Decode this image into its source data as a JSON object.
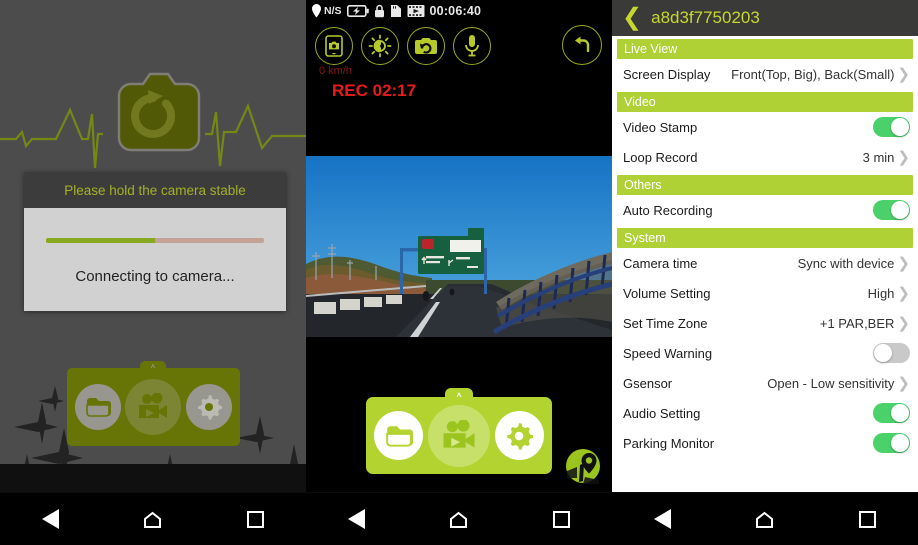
{
  "panel1": {
    "name": "connecting-screen",
    "logo_icon": "camera-refresh-icon",
    "dialog": {
      "title": "Please hold the camera stable",
      "message": "Connecting to camera...",
      "progress_percent": 50,
      "progress_fill_color": "#a5ce27",
      "progress_track_color": "#f0c7b7"
    },
    "toolbar": {
      "items": [
        {
          "icon": "folder-icon",
          "name": "gallery-button"
        },
        {
          "icon": "video-camera-icon",
          "name": "live-view-button"
        },
        {
          "icon": "gear-icon",
          "name": "settings-button"
        }
      ],
      "expand_chevron": "˄"
    }
  },
  "panel2": {
    "name": "live-view-screen",
    "statusbar": {
      "gps_label": "N/S",
      "time": "00:06:40",
      "icons": [
        "location-pin-icon",
        "battery-charging-icon",
        "lock-icon",
        "sd-card-icon",
        "film-strip-icon"
      ]
    },
    "tools": [
      {
        "icon": "phone-snapshot-icon",
        "name": "snapshot-to-phone-button"
      },
      {
        "icon": "brightness-icon",
        "name": "brightness-button"
      },
      {
        "icon": "camera-switch-icon",
        "name": "camera-switch-button"
      },
      {
        "icon": "microphone-icon",
        "name": "microphone-button"
      }
    ],
    "back_icon": "back-arrow-icon",
    "speed": "0 km/h",
    "rec_status": "REC 02:17",
    "speed_color": "#8c1313",
    "rec_color": "#e81b1b",
    "gps_map_icon": "map-pin-icon",
    "toolbar": {
      "items": [
        {
          "icon": "folder-icon",
          "name": "gallery-button"
        },
        {
          "icon": "video-camera-icon",
          "name": "live-view-button"
        },
        {
          "icon": "gear-icon",
          "name": "settings-button"
        }
      ],
      "expand_chevron": "˄"
    }
  },
  "panel3": {
    "name": "settings-screen",
    "header": {
      "back_icon": "chevron-left-icon",
      "title": "a8d3f7750203"
    },
    "accent_color": "#b0d136",
    "toggle_on_color": "#4ad16a",
    "toggle_off_color": "#c9c9c9",
    "sections": [
      {
        "title": "Live View",
        "rows": [
          {
            "label": "Screen Display",
            "value": "Front(Top, Big), Back(Small)",
            "type": "chevron"
          }
        ]
      },
      {
        "title": "Video",
        "rows": [
          {
            "label": "Video Stamp",
            "value": "",
            "type": "toggle",
            "state": "on"
          },
          {
            "label": "Loop Record",
            "value": "3 min",
            "type": "chevron"
          }
        ]
      },
      {
        "title": "Others",
        "rows": [
          {
            "label": "Auto Recording",
            "value": "",
            "type": "toggle",
            "state": "on"
          }
        ]
      },
      {
        "title": "System",
        "rows": [
          {
            "label": "Camera time",
            "value": "Sync with device",
            "type": "chevron"
          },
          {
            "label": "Volume Setting",
            "value": "High",
            "type": "chevron"
          },
          {
            "label": "Set Time Zone",
            "value": "+1 PAR,BER",
            "type": "chevron"
          },
          {
            "label": "Speed Warning",
            "value": "",
            "type": "toggle",
            "state": "off"
          },
          {
            "label": "Gsensor",
            "value": "Open - Low sensitivity",
            "type": "chevron"
          },
          {
            "label": "Audio Setting",
            "value": "",
            "type": "toggle",
            "state": "on"
          },
          {
            "label": "Parking Monitor",
            "value": "",
            "type": "toggle",
            "state": "on"
          }
        ]
      }
    ]
  },
  "navbar": {
    "back_icon": "triangle-back-icon",
    "home_icon": "home-icon",
    "recents_icon": "square-recents-icon"
  }
}
